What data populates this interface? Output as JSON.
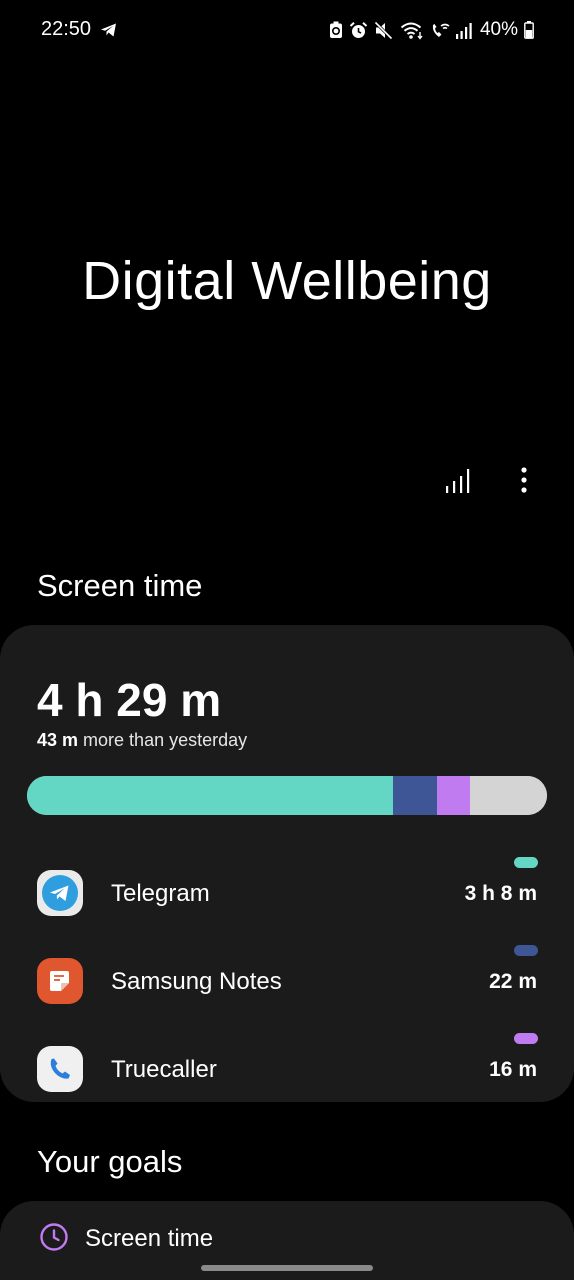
{
  "status_bar": {
    "time": "22:50",
    "battery": "40%",
    "icons": [
      "telegram-icon",
      "battery-saver-icon",
      "alarm-icon",
      "mute-icon",
      "wifi-icon",
      "wifi-calling-icon",
      "signal-icon",
      "battery-icon"
    ]
  },
  "page": {
    "title": "Digital Wellbeing"
  },
  "toolbar": {
    "icons": [
      "bar-chart-icon",
      "more-options-icon"
    ]
  },
  "screen_time": {
    "section_title": "Screen time",
    "total": "4 h 29 m",
    "compare_value": "43 m",
    "compare_text": "more than yesterday",
    "bar_segments": [
      {
        "name": "Telegram",
        "fraction": 0.7036,
        "color": "#64d6c4"
      },
      {
        "name": "Samsung Notes",
        "fraction": 0.0852,
        "color": "#3e5596"
      },
      {
        "name": "Truecaller",
        "fraction": 0.0629,
        "color": "#c07bf1"
      },
      {
        "name": "Other",
        "fraction": 0.1483,
        "color": "#d4d4d4"
      }
    ],
    "apps": [
      {
        "name": "Telegram",
        "time": "3 h 8 m",
        "color": "#64d6c4",
        "icon": "telegram-app-icon"
      },
      {
        "name": "Samsung Notes",
        "time": "22 m",
        "color": "#3e5596",
        "icon": "samsung-notes-app-icon"
      },
      {
        "name": "Truecaller",
        "time": "16 m",
        "color": "#c07bf1",
        "icon": "truecaller-app-icon"
      }
    ]
  },
  "goals": {
    "section_title": "Your goals",
    "items": [
      {
        "label": "Screen time",
        "icon": "clock-icon",
        "color": "#c07bf1"
      }
    ]
  }
}
